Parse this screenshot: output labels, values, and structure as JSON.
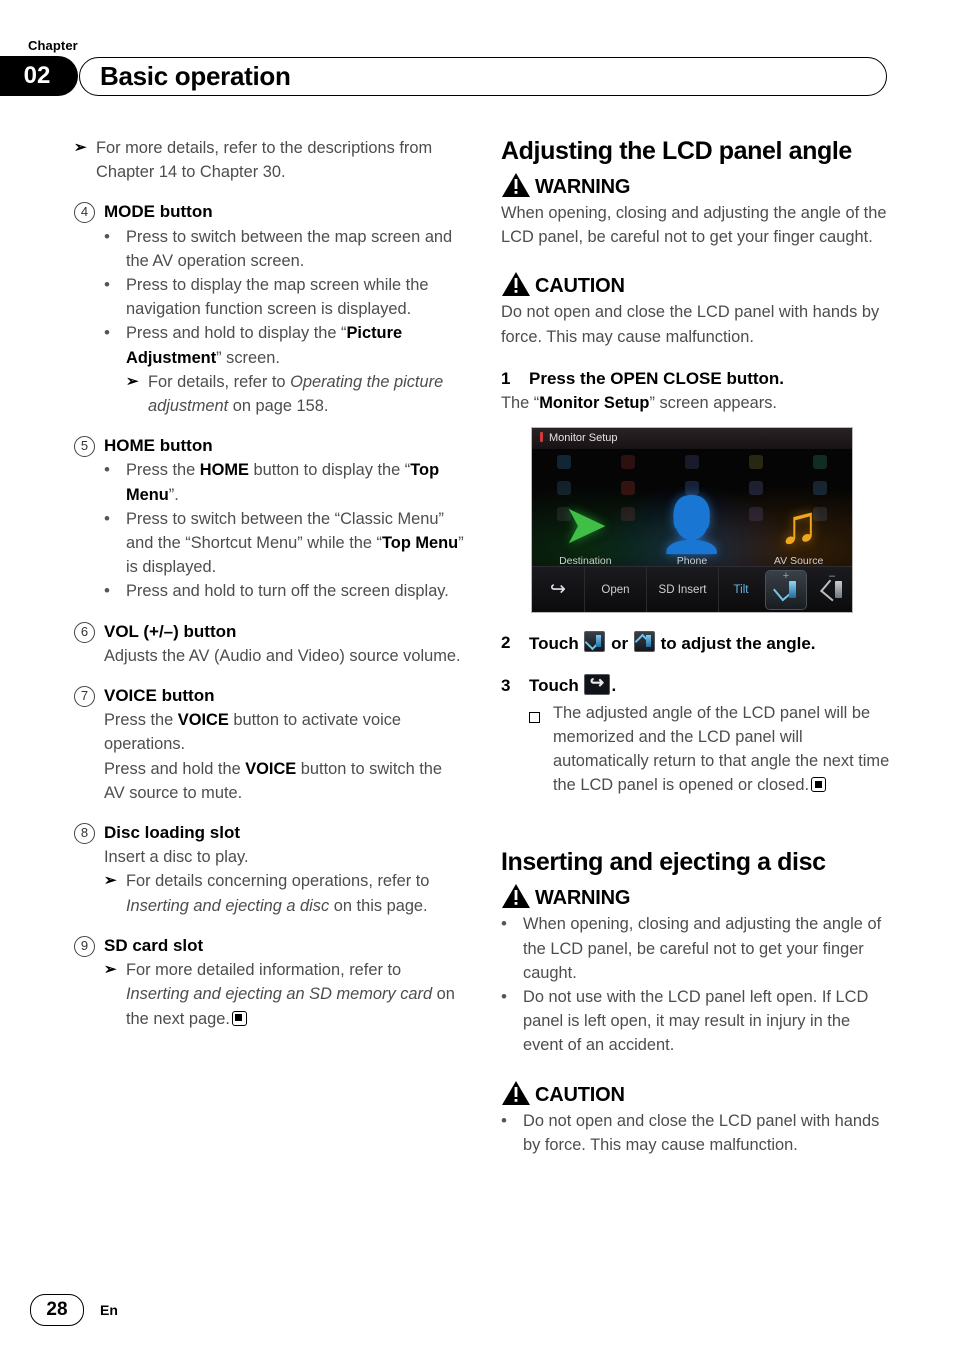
{
  "header": {
    "chapter_word": "Chapter",
    "chapter_number": "02",
    "title": "Basic operation"
  },
  "footer": {
    "page_number": "28",
    "language": "En"
  },
  "left_column": {
    "intro_ref": "For more details, refer to the descriptions from Chapter 14 to Chapter 30.",
    "items": [
      {
        "marker": "4",
        "title": "MODE button",
        "bullets": [
          "Press to switch between the map screen and the AV operation screen.",
          "Press to display the map screen while the navigation function screen is displayed.",
          "Press and hold to display the “Picture Adjustment” screen."
        ],
        "bullet_bold_terms": [
          "Picture Adjustment"
        ],
        "sub_ref_plain_1": "For details, refer to ",
        "sub_ref_italic": "Operating the picture adjustment",
        "sub_ref_plain_2": " on page 158."
      },
      {
        "marker": "5",
        "title": "HOME button",
        "bullets": [
          "Press the HOME button to display the “Top Menu”.",
          "Press to switch between the “Classic Menu” and the “Shortcut Menu” while the “Top Menu” is displayed.",
          "Press and hold to turn off the screen display."
        ]
      },
      {
        "marker": "6",
        "title": "VOL (+/–) button",
        "body": "Adjusts the AV (Audio and Video) source volume."
      },
      {
        "marker": "7",
        "title": "VOICE button",
        "body_1_a": "Press the ",
        "body_1_b": "VOICE",
        "body_1_c": " button to activate voice operations.",
        "body_2_a": "Press and hold the ",
        "body_2_b": "VOICE",
        "body_2_c": " button to switch the AV source to mute."
      },
      {
        "marker": "8",
        "title": "Disc loading slot",
        "body": "Insert a disc to play.",
        "ref_plain_1": "For details concerning operations, refer to ",
        "ref_italic": "Inserting and ejecting a disc",
        "ref_plain_2": " on this page."
      },
      {
        "marker": "9",
        "title": "SD card slot",
        "ref_plain_1": "For more detailed information, refer to ",
        "ref_italic": "Inserting and ejecting an SD memory card",
        "ref_plain_2": " on the next page."
      }
    ]
  },
  "right_column": {
    "section_1": {
      "heading": "Adjusting the LCD panel angle",
      "warning_label": "WARNING",
      "warning_text": "When opening, closing and adjusting the angle of the LCD panel, be careful not to get your finger caught.",
      "caution_label": "CAUTION",
      "caution_text": "Do not open and close the LCD panel with hands by force. This may cause malfunction.",
      "steps": [
        {
          "number": "1",
          "title": "Press the OPEN CLOSE button.",
          "sub_a": "The “",
          "sub_b": "Monitor Setup",
          "sub_c": "” screen appears."
        },
        {
          "number": "2",
          "title_a": "Touch ",
          "title_b": " or ",
          "title_c": " to adjust the angle."
        },
        {
          "number": "3",
          "title_a": "Touch ",
          "title_c": ".",
          "note": "The adjusted angle of the LCD panel will be memorized and the LCD panel will automatically return to that angle the next time the LCD panel is opened or closed."
        }
      ]
    },
    "section_2": {
      "heading": "Inserting and ejecting a disc",
      "warning_label": "WARNING",
      "warning_bullets": [
        "When opening, closing and adjusting the angle of the LCD panel, be careful not to get your finger caught.",
        "Do not use with the LCD panel left open. If LCD panel is left open, it may result in injury in the event of an accident."
      ],
      "caution_label": "CAUTION",
      "caution_bullets": [
        "Do not open and close the LCD panel with hands by force. This may cause malfunction."
      ]
    }
  },
  "screenshot": {
    "title": "Monitor Setup",
    "stage": [
      {
        "label": "Destination",
        "icon": "destination-arrow-icon"
      },
      {
        "label": "Phone",
        "icon": "person-icon"
      },
      {
        "label": "AV Source",
        "icon": "music-note-icon"
      }
    ],
    "toolbar": [
      {
        "label": "",
        "icon": "back-arrow-icon"
      },
      {
        "label": "Open",
        "icon": ""
      },
      {
        "label": "SD Insert",
        "icon": ""
      },
      {
        "label": "Tilt",
        "icon": ""
      },
      {
        "label": "+",
        "icon": "tilt-up-icon"
      },
      {
        "label": "–",
        "icon": "tilt-down-icon"
      }
    ]
  }
}
